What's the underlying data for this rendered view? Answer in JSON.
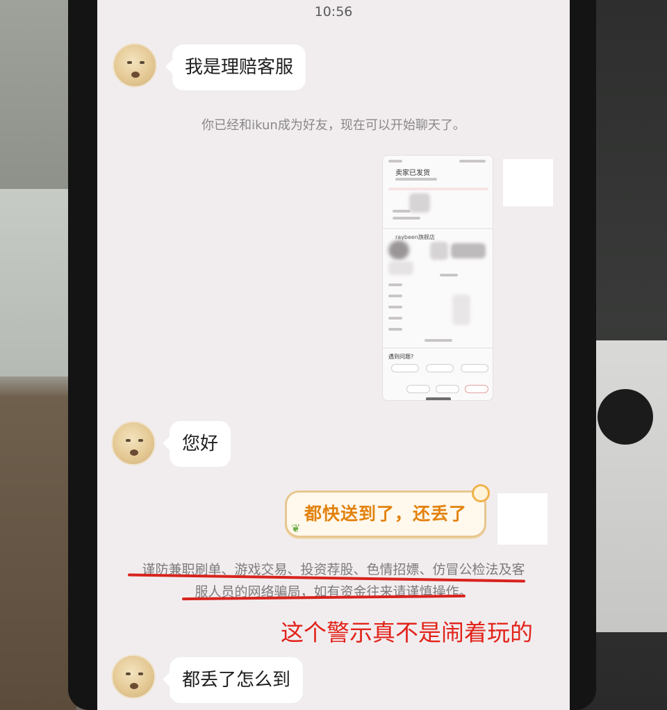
{
  "status_bar": {
    "time": "10:56"
  },
  "chat": {
    "messages": [
      {
        "from": "other",
        "text": "我是理赔客服"
      },
      {
        "from": "system",
        "text": "你已经和ikun成为好友，现在可以开始聊天了。"
      },
      {
        "from": "self",
        "type": "image",
        "description_hidden": true
      },
      {
        "from": "other",
        "text": "您好"
      },
      {
        "from": "self",
        "type": "sticker",
        "text": "都快送到了，还丢了"
      },
      {
        "from": "other",
        "text": "都丢了怎么到"
      }
    ],
    "warning_text_line1": "谨防兼职刷单、游戏交易、投资荐股、色情招嫖、仿冒公检法及客",
    "warning_text_line2": "服人员的网络骗局，如有资金往来请谨慎操作。"
  },
  "sent_screenshot": {
    "title": "卖家已发货",
    "store_name": "raybeen旗舰店",
    "help_title": "遇到问题?"
  },
  "annotation": {
    "text": "这个警示真不是闹着玩的",
    "color": "#e2231a"
  }
}
